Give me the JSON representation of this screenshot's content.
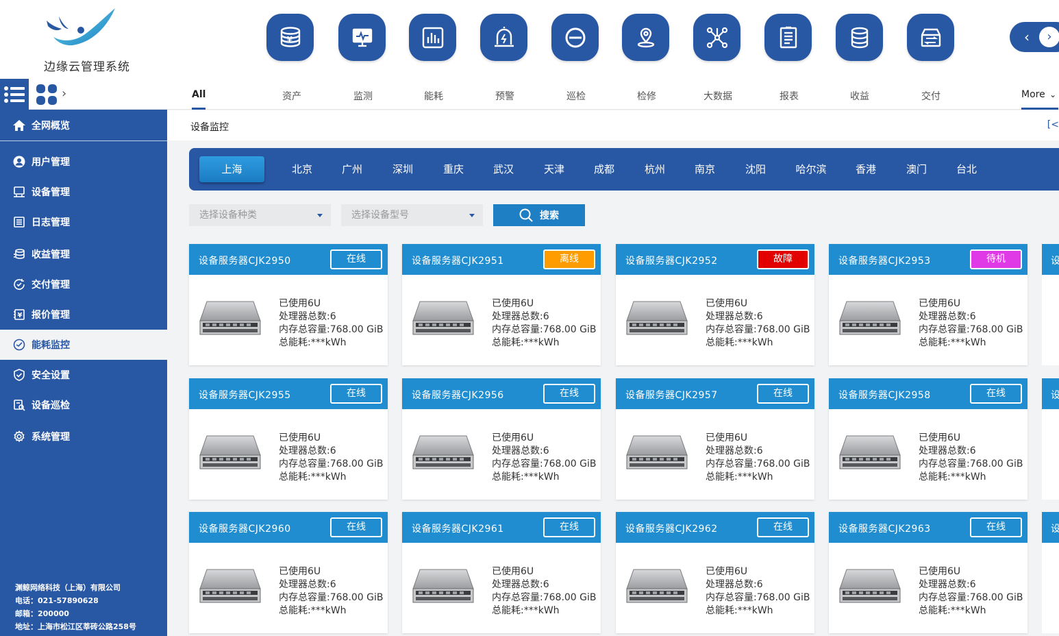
{
  "app": {
    "title": "边缘云管理系统"
  },
  "header": {
    "modules": [
      {
        "icon": "asset-coins-icon"
      },
      {
        "icon": "monitor-icon"
      },
      {
        "icon": "bar-chart-icon"
      },
      {
        "icon": "alarm-icon"
      },
      {
        "icon": "patrol-icon"
      },
      {
        "icon": "location-pin-icon"
      },
      {
        "icon": "network-nodes-icon"
      },
      {
        "icon": "report-icon"
      },
      {
        "icon": "database-icon"
      },
      {
        "icon": "delivery-icon"
      }
    ],
    "tabs": [
      {
        "label": "All"
      },
      {
        "label": "资产"
      },
      {
        "label": "监测"
      },
      {
        "label": "能耗"
      },
      {
        "label": "预警"
      },
      {
        "label": "巡检"
      },
      {
        "label": "检修"
      },
      {
        "label": "大数据"
      },
      {
        "label": "报表"
      },
      {
        "label": "收益"
      },
      {
        "label": "交付"
      }
    ],
    "more_label": "More",
    "prev_glyph": "‹",
    "next_glyph": "›"
  },
  "sidebar": {
    "overview": "全网概览",
    "items": [
      {
        "label": "用户管理",
        "icon": "user-icon"
      },
      {
        "label": "设备管理",
        "icon": "device-icon"
      },
      {
        "label": "日志管理",
        "icon": "log-icon"
      },
      {
        "label": "收益管理",
        "icon": "revenue-icon"
      },
      {
        "label": "交付管理",
        "icon": "delivery-icon"
      },
      {
        "label": "报价管理",
        "icon": "quote-icon"
      },
      {
        "label": "能耗监控",
        "icon": "energy-icon"
      },
      {
        "label": "安全设置",
        "icon": "shield-icon"
      },
      {
        "label": "设备巡检",
        "icon": "inspect-icon"
      },
      {
        "label": "系统管理",
        "icon": "gear-icon"
      }
    ],
    "active_index": 6,
    "company": {
      "name": "渊鲸网络科技（上海）有限公司",
      "phone": "电话：021-57890628",
      "postcode": "邮箱：200000",
      "address": "地址：上海市松江区莘砖公路258号"
    }
  },
  "breadcrumb": {
    "current": "设备监控",
    "right": "[<"
  },
  "cities": [
    "上海",
    "北京",
    "广州",
    "深圳",
    "重庆",
    "武汉",
    "天津",
    "成都",
    "杭州",
    "南京",
    "沈阳",
    "哈尔滨",
    "香港",
    "澳门",
    "台北"
  ],
  "filters": {
    "type_placeholder": "选择设备种类",
    "model_placeholder": "选择设备型号",
    "search_label": "搜索"
  },
  "colors": {
    "brand": "#2857a4",
    "card_header": "#1f8dd0",
    "online": "#1f8dd0",
    "offline": "#ff9d00",
    "fault": "#e30000",
    "standby": "#e03ae6"
  },
  "devices": [
    {
      "name": "设备服务器CJK2950",
      "status": "在线",
      "status_key": "online",
      "used": "已使用6U",
      "cpu": "处理器总数:6",
      "mem": "内存总容量:768.00 GiB",
      "energy": "总能耗:***kWh"
    },
    {
      "name": "设备服务器CJK2951",
      "status": "离线",
      "status_key": "offline",
      "used": "已使用6U",
      "cpu": "处理器总数:6",
      "mem": "内存总容量:768.00 GiB",
      "energy": "总能耗:***kWh"
    },
    {
      "name": "设备服务器CJK2952",
      "status": "故障",
      "status_key": "fault",
      "used": "已使用6U",
      "cpu": "处理器总数:6",
      "mem": "内存总容量:768.00 GiB",
      "energy": "总能耗:***kWh"
    },
    {
      "name": "设备服务器CJK2953",
      "status": "待机",
      "status_key": "standby",
      "used": "已使用6U",
      "cpu": "处理器总数:6",
      "mem": "内存总容量:768.00 GiB",
      "energy": "总能耗:***kWh"
    },
    {
      "name": "设备服务器CJK2955",
      "status": "在线",
      "status_key": "online",
      "used": "已使用6U",
      "cpu": "处理器总数:6",
      "mem": "内存总容量:768.00 GiB",
      "energy": "总能耗:***kWh"
    },
    {
      "name": "设备服务器CJK2956",
      "status": "在线",
      "status_key": "online",
      "used": "已使用6U",
      "cpu": "处理器总数:6",
      "mem": "内存总容量:768.00 GiB",
      "energy": "总能耗:***kWh"
    },
    {
      "name": "设备服务器CJK2957",
      "status": "在线",
      "status_key": "online",
      "used": "已使用6U",
      "cpu": "处理器总数:6",
      "mem": "内存总容量:768.00 GiB",
      "energy": "总能耗:***kWh"
    },
    {
      "name": "设备服务器CJK2958",
      "status": "在线",
      "status_key": "online",
      "used": "已使用6U",
      "cpu": "处理器总数:6",
      "mem": "内存总容量:768.00 GiB",
      "energy": "总能耗:***kWh"
    },
    {
      "name": "设备服务器CJK2960",
      "status": "在线",
      "status_key": "online",
      "used": "已使用6U",
      "cpu": "处理器总数:6",
      "mem": "内存总容量:768.00 GiB",
      "energy": "总能耗:***kWh"
    },
    {
      "name": "设备服务器CJK2961",
      "status": "在线",
      "status_key": "online",
      "used": "已使用6U",
      "cpu": "处理器总数:6",
      "mem": "内存总容量:768.00 GiB",
      "energy": "总能耗:***kWh"
    },
    {
      "name": "设备服务器CJK2962",
      "status": "在线",
      "status_key": "online",
      "used": "已使用6U",
      "cpu": "处理器总数:6",
      "mem": "内存总容量:768.00 GiB",
      "energy": "总能耗:***kWh"
    },
    {
      "name": "设备服务器CJK2963",
      "status": "在线",
      "status_key": "online",
      "used": "已使用6U",
      "cpu": "处理器总数:6",
      "mem": "内存总容量:768.00 GiB",
      "energy": "总能耗:***kWh"
    }
  ],
  "partial_card_label": "设"
}
